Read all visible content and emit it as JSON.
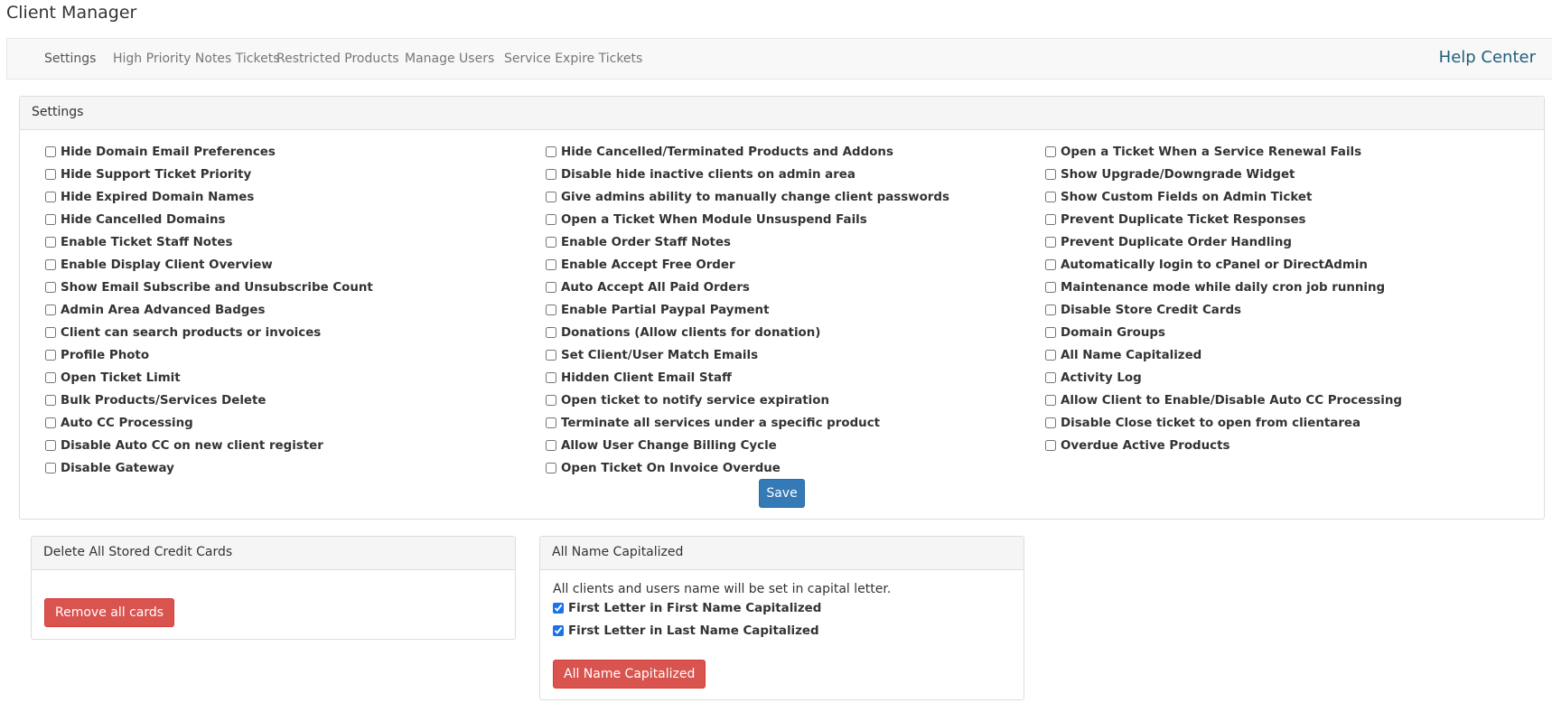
{
  "app": {
    "title": "Client Manager"
  },
  "nav": {
    "tabs": [
      {
        "label": "Settings",
        "active": true
      },
      {
        "label": "High Priority Notes Tickets",
        "active": false
      },
      {
        "label": "Restricted Products",
        "active": false
      },
      {
        "label": "Manage Users",
        "active": false
      },
      {
        "label": "Service Expire Tickets",
        "active": false
      }
    ],
    "help_label": "Help Center"
  },
  "settings": {
    "heading": "Settings",
    "columns": [
      [
        {
          "label": "Hide Domain Email Preferences",
          "checked": false
        },
        {
          "label": "Hide Support Ticket Priority",
          "checked": false
        },
        {
          "label": "Hide Expired Domain Names",
          "checked": false
        },
        {
          "label": "Hide Cancelled Domains",
          "checked": false
        },
        {
          "label": "Enable Ticket Staff Notes",
          "checked": false
        },
        {
          "label": "Enable Display Client Overview",
          "checked": false
        },
        {
          "label": "Show Email Subscribe and Unsubscribe Count",
          "checked": false
        },
        {
          "label": "Admin Area Advanced Badges",
          "checked": false
        },
        {
          "label": "Client can search products or invoices",
          "checked": false
        },
        {
          "label": "Profile Photo",
          "checked": false
        },
        {
          "label": "Open Ticket Limit",
          "checked": false
        },
        {
          "label": "Bulk Products/Services Delete",
          "checked": false
        },
        {
          "label": "Auto CC Processing",
          "checked": false
        },
        {
          "label": "Disable Auto CC on new client register",
          "checked": false
        },
        {
          "label": "Disable Gateway",
          "checked": false
        }
      ],
      [
        {
          "label": "Hide Cancelled/Terminated Products and Addons",
          "checked": false
        },
        {
          "label": "Disable hide inactive clients on admin area",
          "checked": false
        },
        {
          "label": "Give admins ability to manually change client passwords",
          "checked": false
        },
        {
          "label": "Open a Ticket When Module Unsuspend Fails",
          "checked": false
        },
        {
          "label": "Enable Order Staff Notes",
          "checked": false
        },
        {
          "label": "Enable Accept Free Order",
          "checked": false
        },
        {
          "label": "Auto Accept All Paid Orders",
          "checked": false
        },
        {
          "label": "Enable Partial Paypal Payment",
          "checked": false
        },
        {
          "label": "Donations (Allow clients for donation)",
          "checked": false
        },
        {
          "label": "Set Client/User Match Emails",
          "checked": false
        },
        {
          "label": "Hidden Client Email Staff",
          "checked": false
        },
        {
          "label": "Open ticket to notify service expiration",
          "checked": false
        },
        {
          "label": "Terminate all services under a specific product",
          "checked": false
        },
        {
          "label": "Allow User Change Billing Cycle",
          "checked": false
        },
        {
          "label": "Open Ticket On Invoice Overdue",
          "checked": false
        }
      ],
      [
        {
          "label": "Open a Ticket When a Service Renewal Fails",
          "checked": false
        },
        {
          "label": "Show Upgrade/Downgrade Widget",
          "checked": false
        },
        {
          "label": "Show Custom Fields on Admin Ticket",
          "checked": false
        },
        {
          "label": "Prevent Duplicate Ticket Responses",
          "checked": false
        },
        {
          "label": "Prevent Duplicate Order Handling",
          "checked": false
        },
        {
          "label": "Automatically login to cPanel or DirectAdmin",
          "checked": false
        },
        {
          "label": "Maintenance mode while daily cron job running",
          "checked": false
        },
        {
          "label": "Disable Store Credit Cards",
          "checked": false
        },
        {
          "label": "Domain Groups",
          "checked": false
        },
        {
          "label": "All Name Capitalized",
          "checked": false
        },
        {
          "label": "Activity Log",
          "checked": false
        },
        {
          "label": "Allow Client to Enable/Disable Auto CC Processing",
          "checked": false
        },
        {
          "label": "Disable Close ticket to open from clientarea",
          "checked": false
        },
        {
          "label": "Overdue Active Products",
          "checked": false
        }
      ]
    ],
    "save_label": "Save"
  },
  "delete_cards": {
    "heading": "Delete All Stored Credit Cards",
    "button_label": "Remove all cards"
  },
  "name_capitalized": {
    "heading": "All Name Capitalized",
    "description": "All clients and users name will be set in capital letter.",
    "options": [
      {
        "label": "First Letter in First Name Capitalized",
        "checked": true
      },
      {
        "label": "First Letter in Last Name Capitalized",
        "checked": true
      }
    ],
    "button_label": "All Name Capitalized"
  },
  "colors": {
    "primary": "#337ab7",
    "danger": "#d9534f",
    "help_link": "#1f5f7a"
  }
}
